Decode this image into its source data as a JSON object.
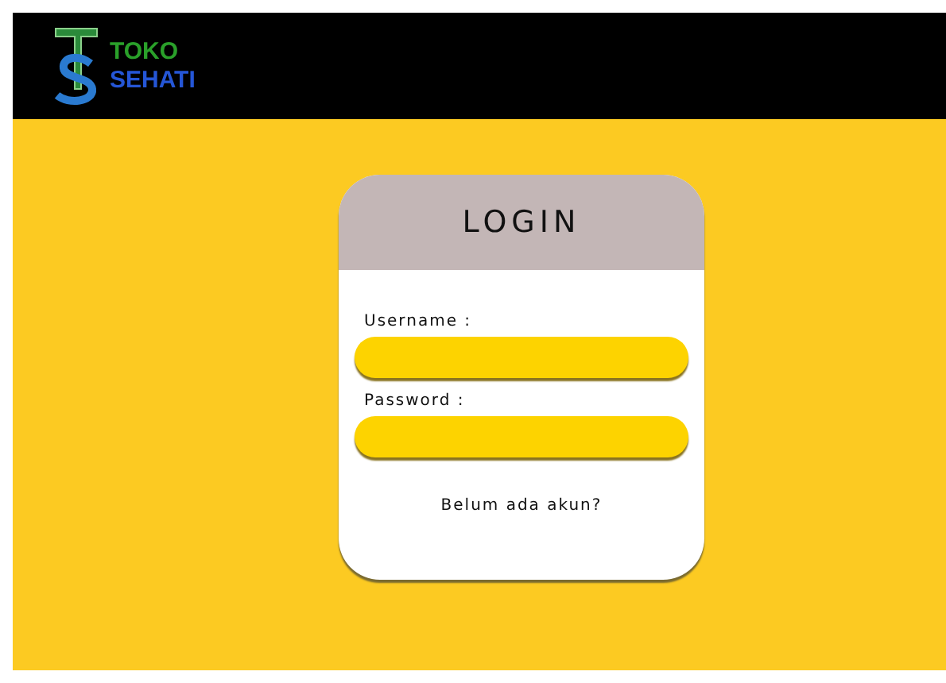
{
  "brand": {
    "line_1": "TOKO",
    "line_2": "SEHATI"
  },
  "login": {
    "title": "LOGIN",
    "fields": [
      {
        "label": "Username :"
      },
      {
        "label": "Password  :"
      }
    ],
    "register_link": "Belum ada akun?"
  }
}
